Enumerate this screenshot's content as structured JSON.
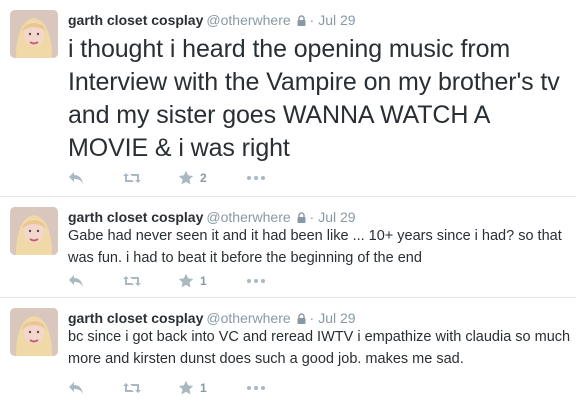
{
  "tweets": [
    {
      "name": "garth closet cosplay",
      "handle": "@otherwhere",
      "time": "Jul 29",
      "text": "i thought i heard the opening music from Interview with the Vampire on my brother's tv and my sister goes WANNA WATCH A MOVIE & i was right",
      "favorites": "2"
    },
    {
      "name": "garth closet cosplay",
      "handle": "@otherwhere",
      "time": "Jul 29",
      "text": "Gabe had never seen it and it had been like ... 10+ years since i had? so that was fun. i had to beat it before the beginning of the end",
      "favorites": "1"
    },
    {
      "name": "garth closet cosplay",
      "handle": "@otherwhere",
      "time": "Jul 29",
      "text": "bc since i got back into VC and reread IWTV i empathize with claudia so much more and kirsten dunst does such a good job. makes me sad.",
      "favorites": "1"
    }
  ],
  "separator": "·",
  "colors": {
    "text": "#292f33",
    "muted": "#8899a6",
    "icon": "#aab8c2",
    "divider": "#e1e8ed"
  },
  "icons": [
    "avatar",
    "lock-icon",
    "reply-icon",
    "retweet-icon",
    "favorite-star-icon",
    "more-icon"
  ]
}
